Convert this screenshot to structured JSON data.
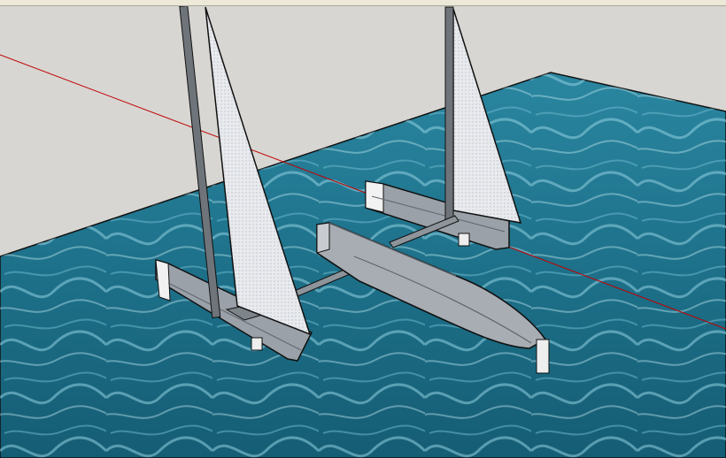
{
  "scene": {
    "sky_color": "#d7d6d2",
    "water_color": "#1f6f86",
    "hull_color": "#9ea4aa",
    "sail_color": "#e4e6ea",
    "axis_color": "#c00000"
  },
  "toolbar": {
    "icons": [
      "select-tool-icon",
      "eraser-tool-icon",
      "paint-tool-icon",
      "line-tool-icon",
      "arc-tool-icon",
      "shape-tool-icon",
      "push-pull-tool-icon",
      "move-tool-icon",
      "rotate-tool-icon",
      "scale-tool-icon",
      "offset-tool-icon",
      "tape-tool-icon",
      "orbit-tool-icon",
      "pan-tool-icon",
      "zoom-tool-icon"
    ]
  }
}
